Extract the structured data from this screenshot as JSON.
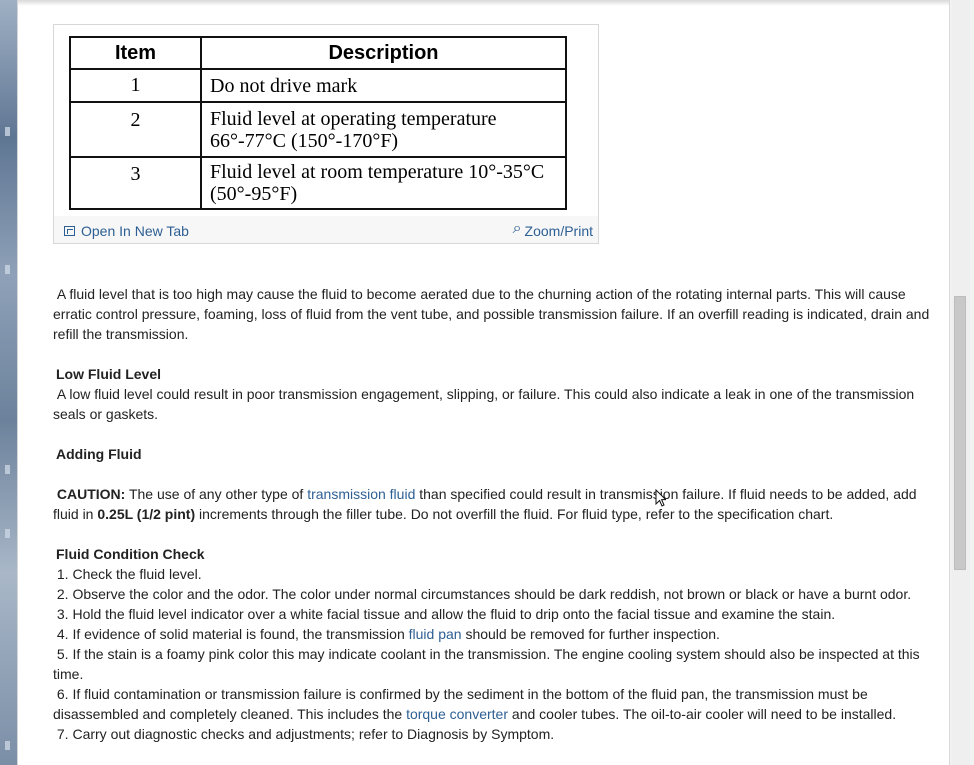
{
  "figure": {
    "table": {
      "headers": [
        "Item",
        "Description"
      ],
      "rows": [
        {
          "item": "1",
          "lines": [
            "Do not drive mark"
          ]
        },
        {
          "item": "2",
          "lines": [
            "Fluid level at operating temperature",
            "66°-77°C (150°-170°F)"
          ]
        },
        {
          "item": "3",
          "lines": [
            "Fluid level at room temperature 10°-35°C",
            "(50°-95°F)"
          ]
        }
      ]
    },
    "open_new_tab_label": "Open In New Tab",
    "zoom_print_label": "Zoom/Print"
  },
  "content": {
    "intro_text": "A fluid level that is too high may cause the fluid to become aerated due to the churning action of the rotating internal parts. This will cause erratic control pressure, foaming, loss of fluid from the vent tube, and possible transmission failure. If an overfill reading is indicated, drain and refill the transmission.",
    "low_fluid_heading": "Low Fluid Level",
    "low_fluid_text": "A low fluid level could result in poor transmission engagement, slipping, or failure. This could also indicate a leak in one of the transmission seals or gaskets.",
    "adding_fluid_heading": "Adding Fluid",
    "caution_label": "CAUTION:",
    "caution_part1": "The use of any other type of",
    "caution_link": "transmission fluid",
    "caution_part2": "than specified could result in transmission failure. If fluid needs to be added, add fluid in",
    "caution_amount": "0.25L (1/2 pint)",
    "caution_part3": "increments through the filler tube. Do not overfill the fluid. For fluid type, refer to the specification chart.",
    "condition_heading": "Fluid Condition Check",
    "condition_steps": [
      {
        "text": "1. Check the fluid level."
      },
      {
        "text": "2. Observe the color and the odor. The color under normal circumstances should be dark reddish, not brown or black or have a burnt odor."
      },
      {
        "text": "3. Hold the fluid level indicator over a white facial tissue and allow the fluid to drip onto the facial tissue and examine the stain."
      },
      {
        "before": "4. If evidence of solid material is found, the transmission",
        "link": "fluid pan",
        "after": "should be removed for further inspection."
      },
      {
        "text": "5. If the stain is a foamy pink color this may indicate coolant in the transmission. The engine cooling system should also be inspected at this time."
      },
      {
        "before": "6. If fluid contamination or transmission failure is confirmed by the sediment in the bottom of the fluid pan, the transmission must be disassembled and completely cleaned. This includes the",
        "link": "torque converter",
        "after": "and cooler tubes. The oil-to-air cooler will need to be installed."
      },
      {
        "text": "7. Carry out diagnostic checks and adjustments; refer to Diagnosis by Symptom."
      }
    ]
  },
  "colors": {
    "link": "#2d5f93",
    "text": "#222222",
    "scroll_thumb": "#c8c8c8"
  }
}
